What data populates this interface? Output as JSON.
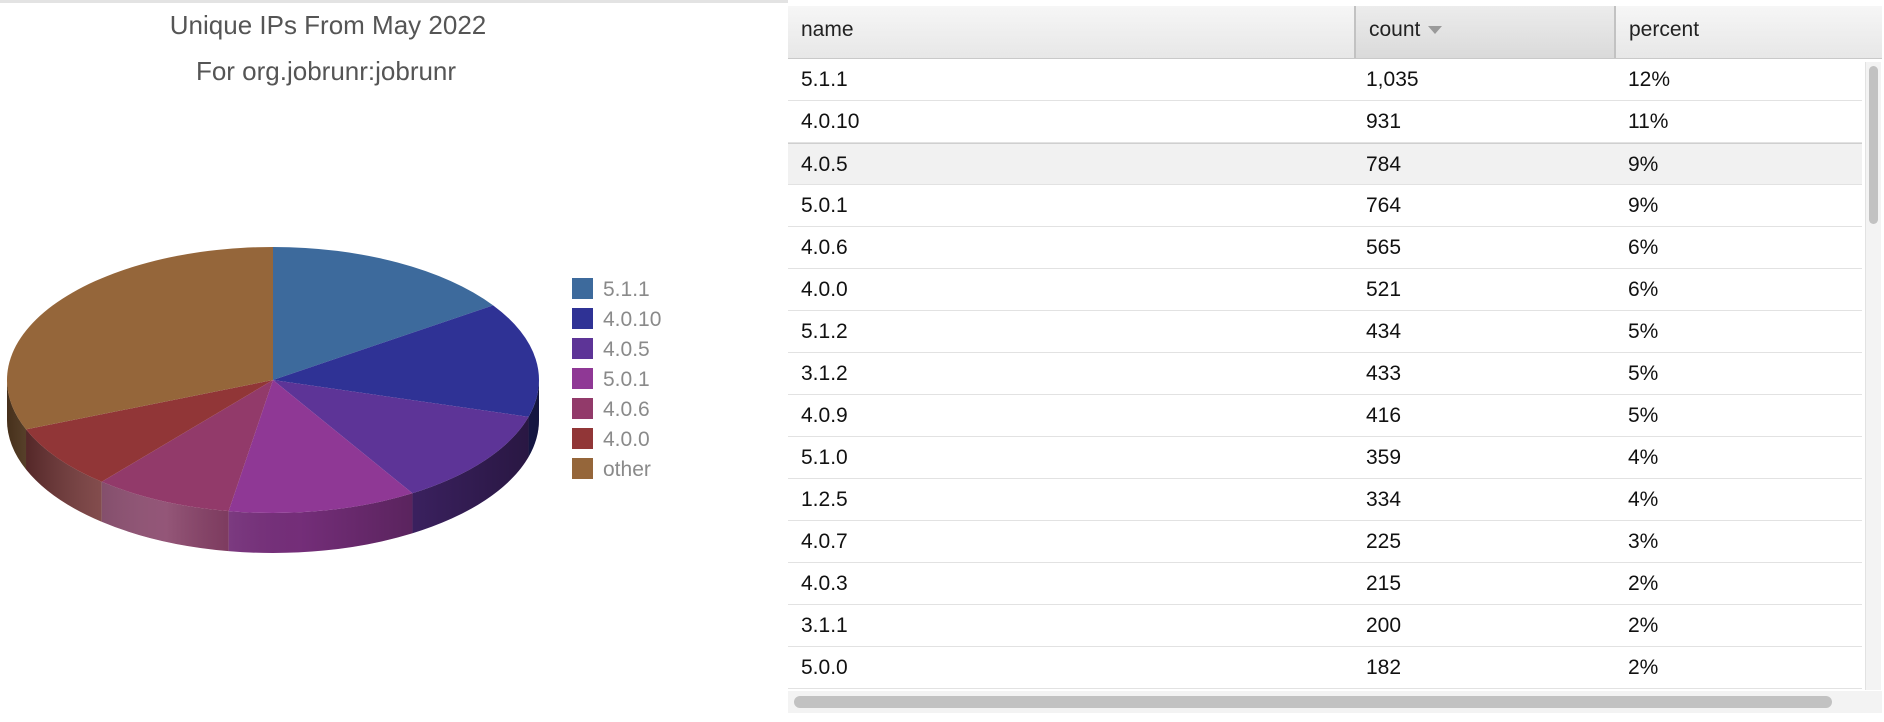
{
  "chart_data": {
    "type": "pie",
    "title": "Unique IPs From May 2022",
    "subtitle": "For org.jobrunr:jobrunr",
    "legend_position": "right",
    "categories": [
      "5.1.1",
      "4.0.10",
      "4.0.5",
      "5.0.1",
      "4.0.6",
      "4.0.0",
      "other"
    ],
    "values": [
      1035,
      931,
      784,
      764,
      565,
      521,
      2072
    ],
    "colors": [
      "#3d6a9c",
      "#2f3295",
      "#5d3497",
      "#8f3895",
      "#923a6a",
      "#913637",
      "#95663a"
    ]
  },
  "table": {
    "columns": [
      "name",
      "count",
      "percent"
    ],
    "sorted_column": "count",
    "sort_direction": "descending",
    "selected_row": 2,
    "rows": [
      [
        "5.1.1",
        "1,035",
        "12%"
      ],
      [
        "4.0.10",
        "931",
        "11%"
      ],
      [
        "4.0.5",
        "784",
        "9%"
      ],
      [
        "5.0.1",
        "764",
        "9%"
      ],
      [
        "4.0.6",
        "565",
        "6%"
      ],
      [
        "4.0.0",
        "521",
        "6%"
      ],
      [
        "5.1.2",
        "434",
        "5%"
      ],
      [
        "3.1.2",
        "433",
        "5%"
      ],
      [
        "4.0.9",
        "416",
        "5%"
      ],
      [
        "5.1.0",
        "359",
        "4%"
      ],
      [
        "1.2.5",
        "334",
        "4%"
      ],
      [
        "4.0.7",
        "225",
        "3%"
      ],
      [
        "4.0.3",
        "215",
        "2%"
      ],
      [
        "3.1.1",
        "200",
        "2%"
      ],
      [
        "5.0.0",
        "182",
        "2%"
      ]
    ]
  }
}
